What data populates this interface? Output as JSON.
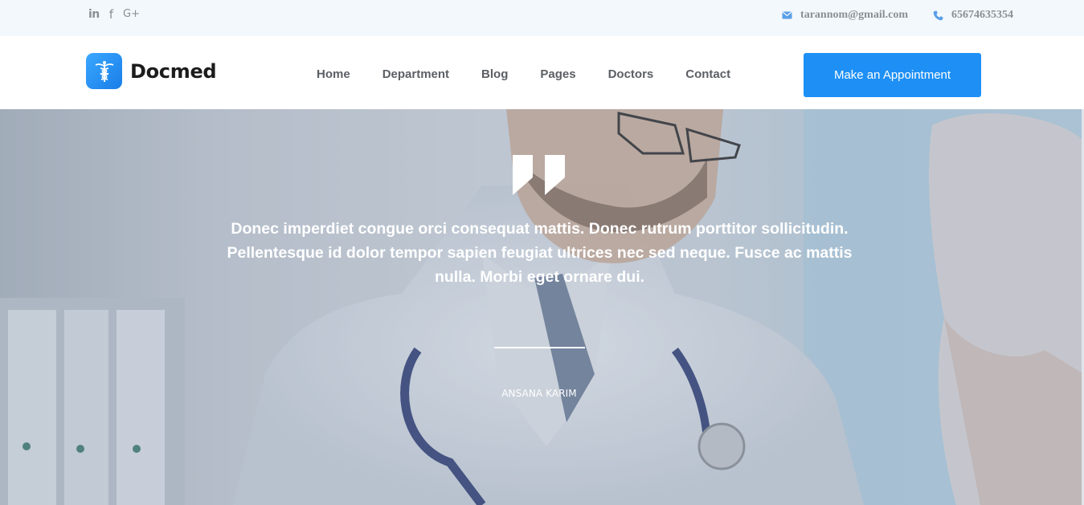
{
  "topbar": {
    "social": [
      {
        "name": "linkedin-icon",
        "glyph": "in"
      },
      {
        "name": "facebook-icon",
        "glyph": "f"
      },
      {
        "name": "google-plus-icon",
        "glyph": "G+"
      }
    ],
    "email": {
      "icon": "envelope-icon",
      "text": "tarannom@gmail.com"
    },
    "phone": {
      "icon": "phone-icon",
      "text": "65674635354"
    }
  },
  "header": {
    "brand": {
      "icon": "caduceus-icon",
      "name": "Docmed"
    },
    "nav": [
      "Home",
      "Department",
      "Blog",
      "Pages",
      "Doctors",
      "Contact"
    ],
    "cta_label": "Make an Appointment"
  },
  "hero": {
    "quote_icon": "quote-mark-icon",
    "quote": "Donec imperdiet congue orci consequat mattis. Donec rutrum porttitor sollicitudin. Pellentesque id dolor tempor sapien feugiat ultrices nec sed neque. Fusce ac mattis nulla. Morbi eget ornare dui.",
    "author": "ANSANA KARIM"
  },
  "colors": {
    "accent": "#1e90f5",
    "topbar_bg": "#f3f8fc",
    "nav_text": "#5b5f64",
    "icon_blue": "#5a9ee6"
  }
}
